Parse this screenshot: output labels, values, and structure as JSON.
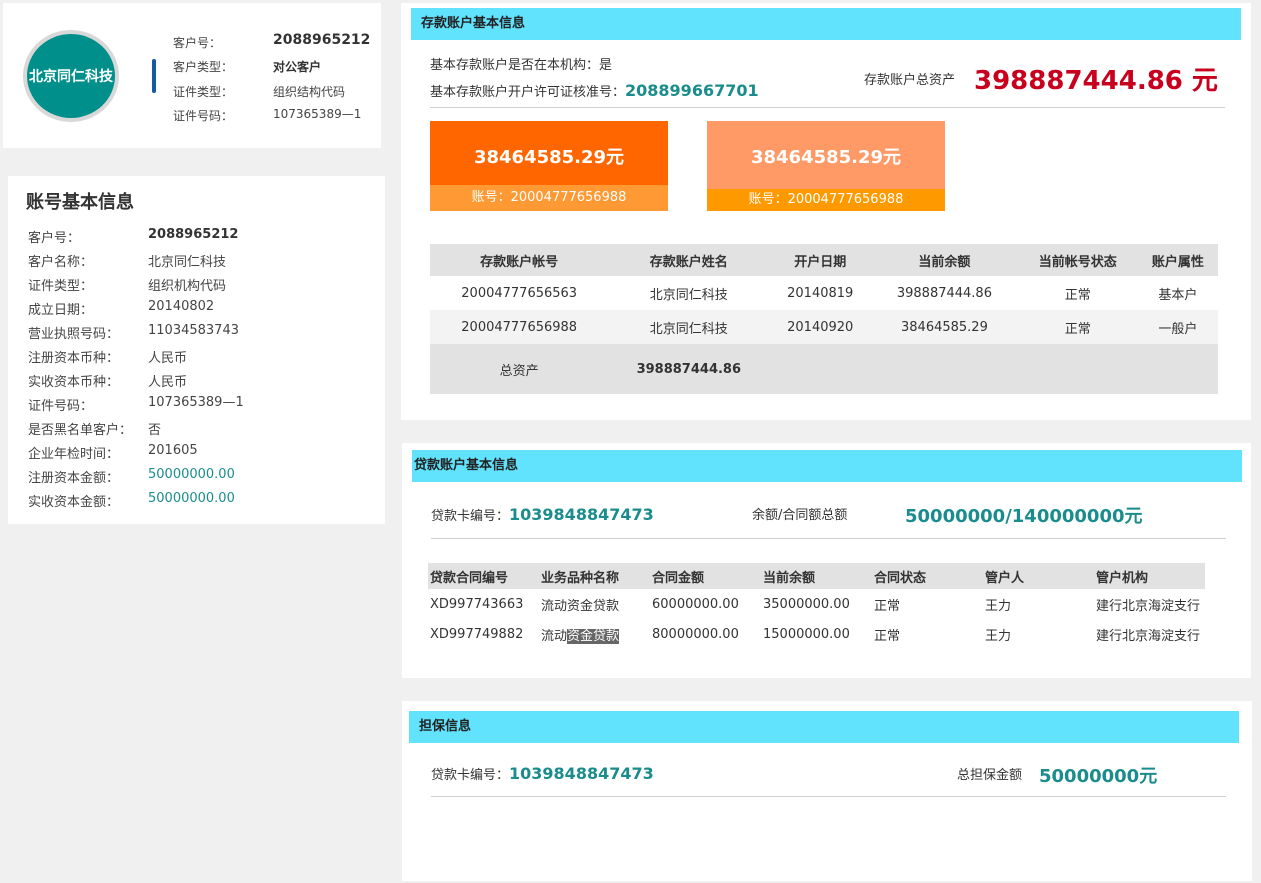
{
  "customer_card": {
    "avatar_text": "北京同仁科技",
    "rows": [
      {
        "label": "客户号：",
        "value": "2088965212"
      },
      {
        "label": "客户类型：",
        "value": "对公客户"
      },
      {
        "label": "证件类型：",
        "value": "组织结构代码"
      },
      {
        "label": "证件号码：",
        "value": "107365389—1"
      }
    ]
  },
  "basic_info": {
    "title": "账号基本信息",
    "rows": [
      {
        "label": "客户号：",
        "value": "2088965212"
      },
      {
        "label": "客户名称：",
        "value": "北京同仁科技"
      },
      {
        "label": "证件类型：",
        "value": "组织机构代码"
      },
      {
        "label": "成立日期：",
        "value": "20140802"
      },
      {
        "label": "营业执照号码：",
        "value": "11034583743"
      },
      {
        "label": "注册资本币种：",
        "value": "人民币"
      },
      {
        "label": "实收资本币种：",
        "value": "人民币"
      },
      {
        "label": "证件号码：",
        "value": "107365389—1"
      },
      {
        "label": "是否黑名单客户：",
        "value": "否"
      },
      {
        "label": "企业年检时间：",
        "value": "201605"
      },
      {
        "label": "注册资本金额：",
        "value": "50000000.00"
      },
      {
        "label": "实收资本金额：",
        "value": "50000000.00"
      }
    ]
  },
  "deposit": {
    "title": "存款账户基本信息",
    "basic_account_label": "基本存款账户是否在本机构：是",
    "license_label": "基本存款账户开户许可证核准号：",
    "license_no": "208899667701",
    "total_label": "存款账户总资产",
    "total_value": "398887444.86 元",
    "cards": [
      {
        "amount": "38464585.29元",
        "account": "账号：20004777656988"
      },
      {
        "amount": "38464585.29元",
        "account": "账号：20004777656988"
      }
    ],
    "table": {
      "headers": [
        "存款账户帐号",
        "存款账户姓名",
        "开户日期",
        "当前余额",
        "当前帐号状态",
        "账户属性"
      ],
      "rows": [
        [
          "20004777656563",
          "北京同仁科技",
          "20140819",
          "398887444.86",
          "正常",
          "基本户"
        ],
        [
          "20004777656988",
          "北京同仁科技",
          "20140920",
          "38464585.29",
          "正常",
          "一般户"
        ]
      ],
      "total_label": "总资产",
      "total_value": "398887444.86"
    }
  },
  "loan": {
    "title": "贷款账户基本信息",
    "card_label": "贷款卡编号：",
    "card_no": "1039848847473",
    "balance_label": "余额/合同额总额",
    "balance_value": "50000000/140000000元",
    "table": {
      "headers": [
        "贷款合同编号",
        "业务品种名称",
        "合同金额",
        "当前余额",
        "合同状态",
        "管户人",
        "管户机构"
      ],
      "rows": [
        [
          "XD997743663",
          "流动资金贷款",
          "60000000.00",
          "35000000.00",
          "正常",
          "王力",
          "建行北京海淀支行"
        ],
        [
          "XD997749882",
          "流动资金贷款",
          "80000000.00",
          "15000000.00",
          "正常",
          "王力",
          "建行北京海淀支行"
        ]
      ],
      "row2_name_prefix": "流动",
      "row2_name_selected": "资金贷款"
    }
  },
  "guarantee": {
    "title": "担保信息",
    "card_label": "贷款卡编号：",
    "card_no": "1039848847473",
    "total_label": "总担保金额",
    "total_value": "50000000元"
  },
  "colors": {
    "section_header": "#61e2fd",
    "teal_value": "#1a8c8c",
    "total_red": "#c8001e",
    "card1_top": "#ff6600",
    "card1_bottom": "#ff9933",
    "card2_top": "#ff9966",
    "card2_bottom": "#ff9900"
  }
}
